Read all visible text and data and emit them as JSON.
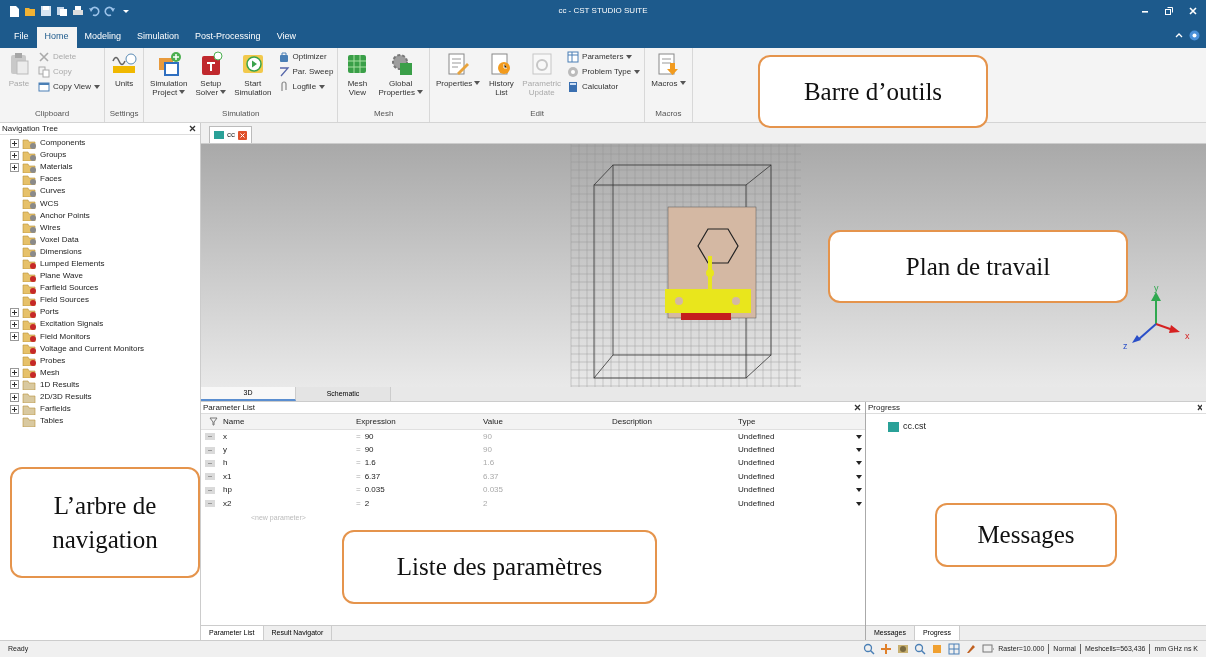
{
  "window": {
    "title": "cc - CST STUDIO SUITE"
  },
  "menu_tabs": [
    {
      "label": "File",
      "selected": false
    },
    {
      "label": "Home",
      "selected": true
    },
    {
      "label": "Modeling",
      "selected": false
    },
    {
      "label": "Simulation",
      "selected": false
    },
    {
      "label": "Post-Processing",
      "selected": false
    },
    {
      "label": "View",
      "selected": false
    }
  ],
  "ribbon_groups": [
    {
      "label": "Clipboard",
      "items": [
        {
          "kind": "large",
          "label": "Paste",
          "disabled": true
        },
        {
          "kind": "stack",
          "items": [
            {
              "label": "Delete",
              "disabled": true
            },
            {
              "label": "Copy",
              "disabled": true
            },
            {
              "label": "Copy View",
              "disabled": false,
              "dropdown": true
            }
          ]
        }
      ]
    },
    {
      "label": "Settings",
      "items": [
        {
          "kind": "large",
          "label": "Units",
          "disabled": false
        }
      ]
    },
    {
      "label": "Simulation",
      "items": [
        {
          "kind": "large",
          "label": "Simulation\nProject",
          "disabled": false,
          "dropdown": true
        },
        {
          "kind": "large",
          "label": "Setup\nSolver",
          "disabled": false,
          "dropdown": true
        },
        {
          "kind": "large",
          "label": "Start\nSimulation",
          "disabled": false
        },
        {
          "kind": "stack",
          "items": [
            {
              "label": "Optimizer",
              "disabled": false
            },
            {
              "label": "Par. Sweep",
              "disabled": false
            },
            {
              "label": "Logfile",
              "disabled": false,
              "dropdown": true
            }
          ]
        }
      ]
    },
    {
      "label": "Mesh",
      "items": [
        {
          "kind": "large",
          "label": "Mesh\nView",
          "disabled": false
        },
        {
          "kind": "large",
          "label": "Global\nProperties",
          "disabled": false,
          "dropdown": true
        }
      ]
    },
    {
      "label": "Edit",
      "items": [
        {
          "kind": "large",
          "label": "Properties",
          "disabled": false,
          "dropdown": true
        },
        {
          "kind": "large",
          "label": "History\nList",
          "disabled": false
        },
        {
          "kind": "large",
          "label": "Parametric\nUpdate",
          "disabled": true
        },
        {
          "kind": "stack",
          "items": [
            {
              "label": "Parameters",
              "disabled": false,
              "dropdown": true
            },
            {
              "label": "Problem Type",
              "disabled": false,
              "dropdown": true
            },
            {
              "label": "Calculator",
              "disabled": false
            }
          ]
        }
      ]
    },
    {
      "label": "Macros",
      "items": [
        {
          "kind": "large",
          "label": "Macros",
          "disabled": false,
          "dropdown": true
        }
      ]
    }
  ],
  "navigation_tree": {
    "title": "Navigation Tree",
    "items": [
      {
        "label": "Components",
        "kind": "model",
        "expanded": false
      },
      {
        "label": "Groups",
        "kind": "model",
        "expanded": false
      },
      {
        "label": "Materials",
        "kind": "model",
        "expanded": false
      },
      {
        "label": "Faces",
        "kind": "model"
      },
      {
        "label": "Curves",
        "kind": "model"
      },
      {
        "label": "WCS",
        "kind": "model"
      },
      {
        "label": "Anchor Points",
        "kind": "model"
      },
      {
        "label": "Wires",
        "kind": "model"
      },
      {
        "label": "Voxel Data",
        "kind": "model"
      },
      {
        "label": "Dimensions",
        "kind": "model"
      },
      {
        "label": "Lumped Elements",
        "kind": "source"
      },
      {
        "label": "Plane Wave",
        "kind": "source"
      },
      {
        "label": "Farfield Sources",
        "kind": "source"
      },
      {
        "label": "Field Sources",
        "kind": "source"
      },
      {
        "label": "Ports",
        "kind": "source",
        "expanded": false
      },
      {
        "label": "Excitation Signals",
        "kind": "source",
        "expanded": false
      },
      {
        "label": "Field Monitors",
        "kind": "source",
        "expanded": false
      },
      {
        "label": "Voltage and Current Monitors",
        "kind": "source"
      },
      {
        "label": "Probes",
        "kind": "source"
      },
      {
        "label": "Mesh",
        "kind": "source",
        "expanded": false
      },
      {
        "label": "1D Results",
        "kind": "result",
        "expanded": false
      },
      {
        "label": "2D/3D Results",
        "kind": "result",
        "expanded": false
      },
      {
        "label": "Farfields",
        "kind": "result",
        "expanded": false
      },
      {
        "label": "Tables",
        "kind": "result"
      }
    ]
  },
  "document_tabs": [
    {
      "label": "cc",
      "selected": true
    }
  ],
  "viewport": {
    "axes": [
      "y",
      "z",
      "x"
    ]
  },
  "view_tabs": [
    {
      "label": "3D",
      "selected": true
    },
    {
      "label": "Schematic",
      "selected": false
    }
  ],
  "parameter_list": {
    "title": "Parameter List",
    "columns": [
      "Name",
      "Expression",
      "Value",
      "Description",
      "Type"
    ],
    "rows": [
      {
        "name": "x",
        "sign": "=",
        "expression": "90",
        "value": "90",
        "type": "Undefined"
      },
      {
        "name": "y",
        "sign": "=",
        "expression": "90",
        "value": "90",
        "type": "Undefined"
      },
      {
        "name": "h",
        "sign": "=",
        "expression": "1.6",
        "value": "1.6",
        "type": "Undefined"
      },
      {
        "name": "x1",
        "sign": "=",
        "expression": "6.37",
        "value": "6.37",
        "type": "Undefined"
      },
      {
        "name": "hp",
        "sign": "=",
        "expression": "0.035",
        "value": "0.035",
        "type": "Undefined"
      },
      {
        "name": "x2",
        "sign": "=",
        "expression": "2",
        "value": "2",
        "type": "Undefined"
      }
    ],
    "new_row": "<new parameter>",
    "tabs": [
      {
        "label": "Parameter List",
        "selected": true
      },
      {
        "label": "Result Navigator",
        "selected": false
      }
    ]
  },
  "progress_panel": {
    "title": "Progress",
    "items": [
      "cc.cst"
    ],
    "tabs": [
      {
        "label": "Messages",
        "selected": false
      },
      {
        "label": "Progress",
        "selected": true
      }
    ]
  },
  "status_bar": {
    "text": "Ready",
    "fields": [
      "Raster=10.000",
      "Normal",
      "Meshcells=563,436",
      "mm GHz ns K"
    ]
  },
  "annotations": [
    {
      "text": "Barre d’outils"
    },
    {
      "text": "Plan de travail"
    },
    {
      "text": "L’arbre de navigation"
    },
    {
      "text": "Liste des paramètres"
    },
    {
      "text": "Messages"
    }
  ]
}
